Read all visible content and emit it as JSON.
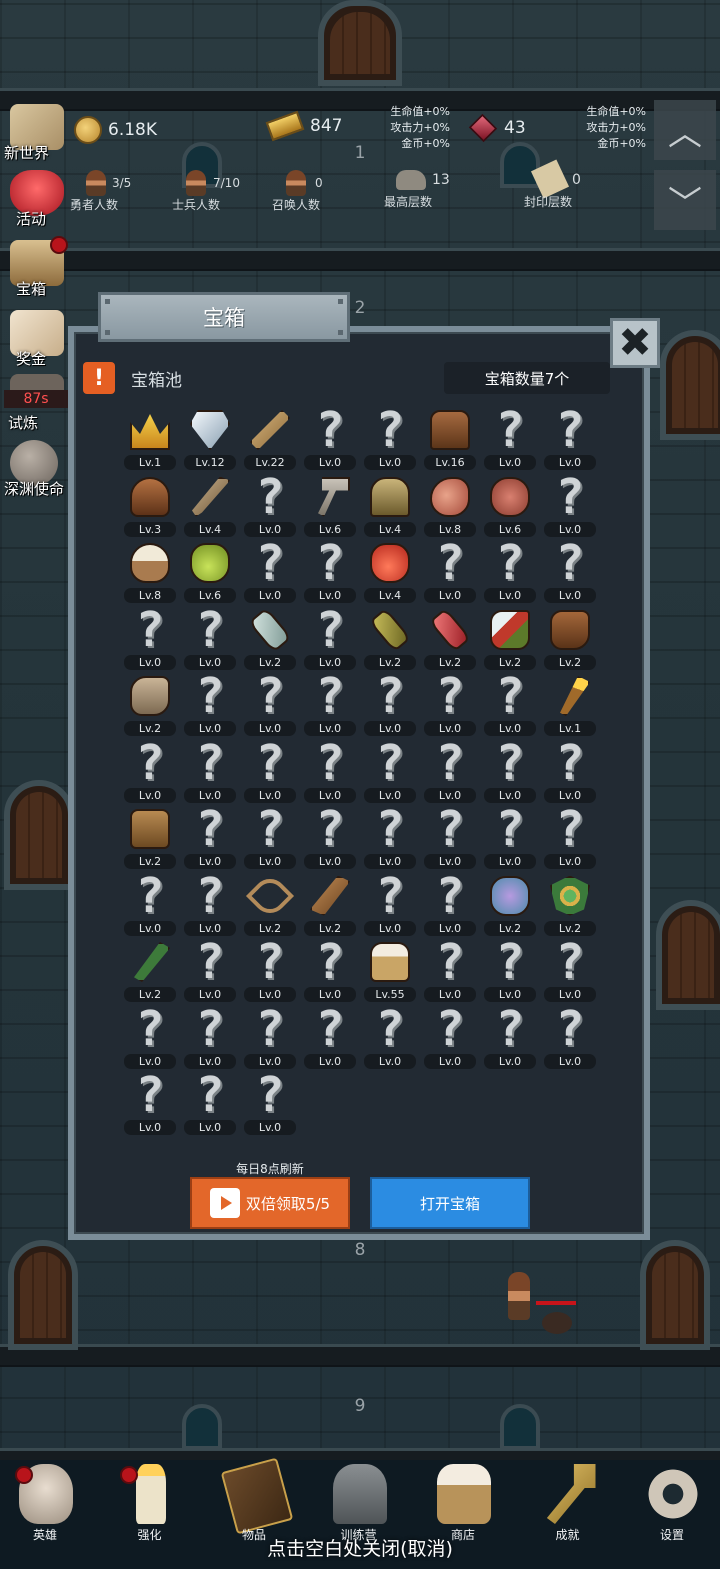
{
  "top_bar": {
    "gold": "6.18K",
    "bars": "847",
    "gems": "43",
    "bonus_left": [
      "生命值+0%",
      "攻击力+0%",
      "金币+0%"
    ],
    "bonus_right": [
      "生命值+0%",
      "攻击力+0%",
      "金币+0%"
    ],
    "hero_count": "3/5",
    "hero_label": "勇者人数",
    "soldier_count": "7/10",
    "soldier_label": "士兵人数",
    "summon_count": "0",
    "summon_label": "召唤人数",
    "max_floor": "13",
    "max_floor_label": "最高层数",
    "sealed_floor": "0",
    "sealed_floor_label": "封印层数"
  },
  "floor_numbers": [
    "1",
    "2",
    "8",
    "9"
  ],
  "side_menu": {
    "items": [
      {
        "label": "新世界",
        "icon": "map-icon"
      },
      {
        "label": "活动",
        "icon": "heart-icon"
      },
      {
        "label": "宝箱",
        "icon": "chest-icon"
      },
      {
        "label": "奖金",
        "icon": "envelope-icon"
      },
      {
        "label": "试炼",
        "icon": "trial-icon",
        "timer": "87s"
      },
      {
        "label": "深渊使命",
        "icon": "stone-icon"
      }
    ]
  },
  "modal": {
    "title": "宝箱",
    "close_symbol": "✖",
    "pool_label": "宝箱池",
    "pool_icon": "!",
    "chest_count": "宝箱数量7个",
    "refresh_note": "每日8点刷新",
    "double_claim": "双倍领取5/5",
    "open_chest": "打开宝箱"
  },
  "items": [
    {
      "icon": "crown",
      "level": "Lv.1"
    },
    {
      "icon": "diamond",
      "level": "Lv.12"
    },
    {
      "icon": "sword",
      "level": "Lv.22"
    },
    {
      "icon": "unknown",
      "level": "Lv.0"
    },
    {
      "icon": "unknown",
      "level": "Lv.0"
    },
    {
      "icon": "leather-armor",
      "level": "Lv.16"
    },
    {
      "icon": "unknown",
      "level": "Lv.0"
    },
    {
      "icon": "unknown",
      "level": "Lv.0"
    },
    {
      "icon": "leather-helmet",
      "level": "Lv.3"
    },
    {
      "icon": "dagger",
      "level": "Lv.4"
    },
    {
      "icon": "unknown",
      "level": "Lv.0"
    },
    {
      "icon": "hammer",
      "level": "Lv.6"
    },
    {
      "icon": "knight-helmet",
      "level": "Lv.4"
    },
    {
      "icon": "ham",
      "level": "Lv.8"
    },
    {
      "icon": "steak",
      "level": "Lv.6"
    },
    {
      "icon": "unknown",
      "level": "Lv.0"
    },
    {
      "icon": "rice-bowl",
      "level": "Lv.8"
    },
    {
      "icon": "green-potion",
      "level": "Lv.6"
    },
    {
      "icon": "unknown",
      "level": "Lv.0"
    },
    {
      "icon": "unknown",
      "level": "Lv.0"
    },
    {
      "icon": "red-potion",
      "level": "Lv.4"
    },
    {
      "icon": "unknown",
      "level": "Lv.0"
    },
    {
      "icon": "unknown",
      "level": "Lv.0"
    },
    {
      "icon": "unknown",
      "level": "Lv.0"
    },
    {
      "icon": "unknown",
      "level": "Lv.0"
    },
    {
      "icon": "unknown",
      "level": "Lv.0"
    },
    {
      "icon": "glass-vial",
      "level": "Lv.2"
    },
    {
      "icon": "unknown",
      "level": "Lv.0"
    },
    {
      "icon": "olive-bottle",
      "level": "Lv.2"
    },
    {
      "icon": "red-bottle",
      "level": "Lv.2"
    },
    {
      "icon": "winged-boots",
      "level": "Lv.2"
    },
    {
      "icon": "brown-boots",
      "level": "Lv.2"
    },
    {
      "icon": "cloth-shoes",
      "level": "Lv.2"
    },
    {
      "icon": "unknown",
      "level": "Lv.0"
    },
    {
      "icon": "unknown",
      "level": "Lv.0"
    },
    {
      "icon": "unknown",
      "level": "Lv.0"
    },
    {
      "icon": "unknown",
      "level": "Lv.0"
    },
    {
      "icon": "unknown",
      "level": "Lv.0"
    },
    {
      "icon": "unknown",
      "level": "Lv.0"
    },
    {
      "icon": "torch",
      "level": "Lv.1"
    },
    {
      "icon": "unknown",
      "level": "Lv.0"
    },
    {
      "icon": "unknown",
      "level": "Lv.0"
    },
    {
      "icon": "unknown",
      "level": "Lv.0"
    },
    {
      "icon": "unknown",
      "level": "Lv.0"
    },
    {
      "icon": "unknown",
      "level": "Lv.0"
    },
    {
      "icon": "unknown",
      "level": "Lv.0"
    },
    {
      "icon": "unknown",
      "level": "Lv.0"
    },
    {
      "icon": "unknown",
      "level": "Lv.0"
    },
    {
      "icon": "backpack",
      "level": "Lv.2"
    },
    {
      "icon": "unknown",
      "level": "Lv.0"
    },
    {
      "icon": "unknown",
      "level": "Lv.0"
    },
    {
      "icon": "unknown",
      "level": "Lv.0"
    },
    {
      "icon": "unknown",
      "level": "Lv.0"
    },
    {
      "icon": "unknown",
      "level": "Lv.0"
    },
    {
      "icon": "unknown",
      "level": "Lv.0"
    },
    {
      "icon": "unknown",
      "level": "Lv.0"
    },
    {
      "icon": "unknown",
      "level": "Lv.0"
    },
    {
      "icon": "unknown",
      "level": "Lv.0"
    },
    {
      "icon": "bow",
      "level": "Lv.2"
    },
    {
      "icon": "quiver",
      "level": "Lv.2"
    },
    {
      "icon": "unknown",
      "level": "Lv.0"
    },
    {
      "icon": "unknown",
      "level": "Lv.0"
    },
    {
      "icon": "tentacle-charm",
      "level": "Lv.2"
    },
    {
      "icon": "shield-emblem",
      "level": "Lv.2"
    },
    {
      "icon": "staff",
      "level": "Lv.2"
    },
    {
      "icon": "unknown",
      "level": "Lv.0"
    },
    {
      "icon": "unknown",
      "level": "Lv.0"
    },
    {
      "icon": "unknown",
      "level": "Lv.0"
    },
    {
      "icon": "beer-mug",
      "level": "Lv.55"
    },
    {
      "icon": "unknown",
      "level": "Lv.0"
    },
    {
      "icon": "unknown",
      "level": "Lv.0"
    },
    {
      "icon": "unknown",
      "level": "Lv.0"
    },
    {
      "icon": "unknown",
      "level": "Lv.0"
    },
    {
      "icon": "unknown",
      "level": "Lv.0"
    },
    {
      "icon": "unknown",
      "level": "Lv.0"
    },
    {
      "icon": "unknown",
      "level": "Lv.0"
    },
    {
      "icon": "unknown",
      "level": "Lv.0"
    },
    {
      "icon": "unknown",
      "level": "Lv.0"
    },
    {
      "icon": "unknown",
      "level": "Lv.0"
    },
    {
      "icon": "unknown",
      "level": "Lv.0"
    },
    {
      "icon": "unknown",
      "level": "Lv.0"
    },
    {
      "icon": "unknown",
      "level": "Lv.0"
    },
    {
      "icon": "unknown",
      "level": "Lv.0"
    }
  ],
  "bottom_nav": [
    {
      "label": "英雄",
      "icon": "skull-icon",
      "badge": true
    },
    {
      "label": "强化",
      "icon": "candle-icon",
      "badge": true
    },
    {
      "label": "物品",
      "icon": "book-icon",
      "badge": false
    },
    {
      "label": "训练营",
      "icon": "lantern-icon",
      "badge": false
    },
    {
      "label": "商店",
      "icon": "mug-icon",
      "badge": false
    },
    {
      "label": "成就",
      "icon": "key-icon",
      "badge": false
    },
    {
      "label": "设置",
      "icon": "gear-icon",
      "badge": false
    }
  ],
  "close_hint": "点击空白处关闭(取消)",
  "colors": {
    "modal_bg": "#222a33",
    "modal_border": "#7b8d99",
    "double_btn": "#e3672a",
    "open_btn": "#2b8ce2",
    "badge_red": "#b8141b"
  }
}
